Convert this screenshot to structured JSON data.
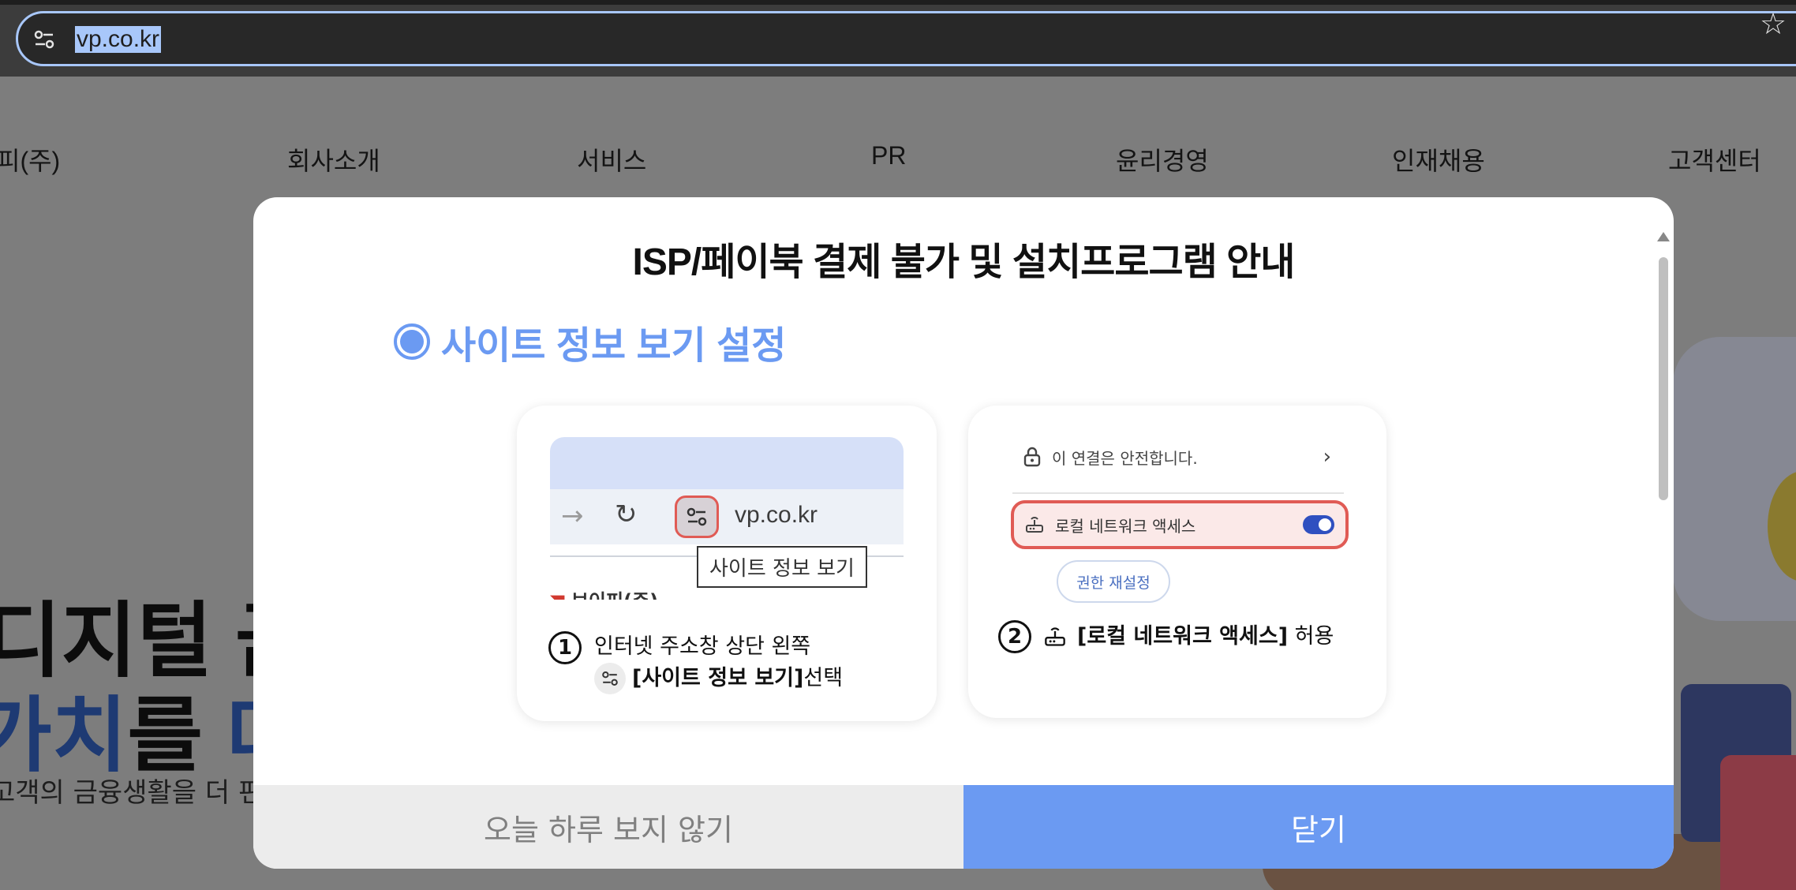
{
  "browser": {
    "url": "vp.co.kr",
    "site_info_icon": "tune-icon",
    "bookmark_icon": "star-icon"
  },
  "site": {
    "brand": "피(주)",
    "nav": [
      "회사소개",
      "서비스",
      "PR",
      "윤리경영",
      "인재채용",
      "고객센터"
    ],
    "hero_line1": "디지털 금융",
    "hero_line2_accent": "가치",
    "hero_line2_mid": "를 ",
    "hero_line2_accent2": "더하",
    "hero_sub": "고객의 금융생활을 더 편리"
  },
  "modal": {
    "title": "ISP/페이북 결제 불가 및 설치프로그램 안내",
    "section_heading": "사이트 정보 보기 설정",
    "card1": {
      "mini_url": "vp.co.kr",
      "tooltip": "사이트 정보 보기",
      "mini_brand": "브이피(주)",
      "step_number": "1",
      "step_line1": "인터넷 주소창 상단 왼쪽",
      "step_line2_bold": "[사이트 정보 보기]",
      "step_line2_rest": " 선택"
    },
    "card2": {
      "secure_text": "이 연결은 안전합니다.",
      "local_network_text": "로컬 네트워크 액세스",
      "toggle_on": true,
      "reset_button": "권한 재설정",
      "step_number": "2",
      "step_bold": "[로컬 네트워크 액세스]",
      "step_rest": " 허용"
    },
    "footer": {
      "no_show_today": "오늘 하루 보지 않기",
      "close": "닫기"
    }
  },
  "colors": {
    "accent": "#6b9af2",
    "highlight_red": "#e05b55",
    "toggle_blue": "#2f50c0",
    "overlay_gray": "#7c7c7c"
  }
}
